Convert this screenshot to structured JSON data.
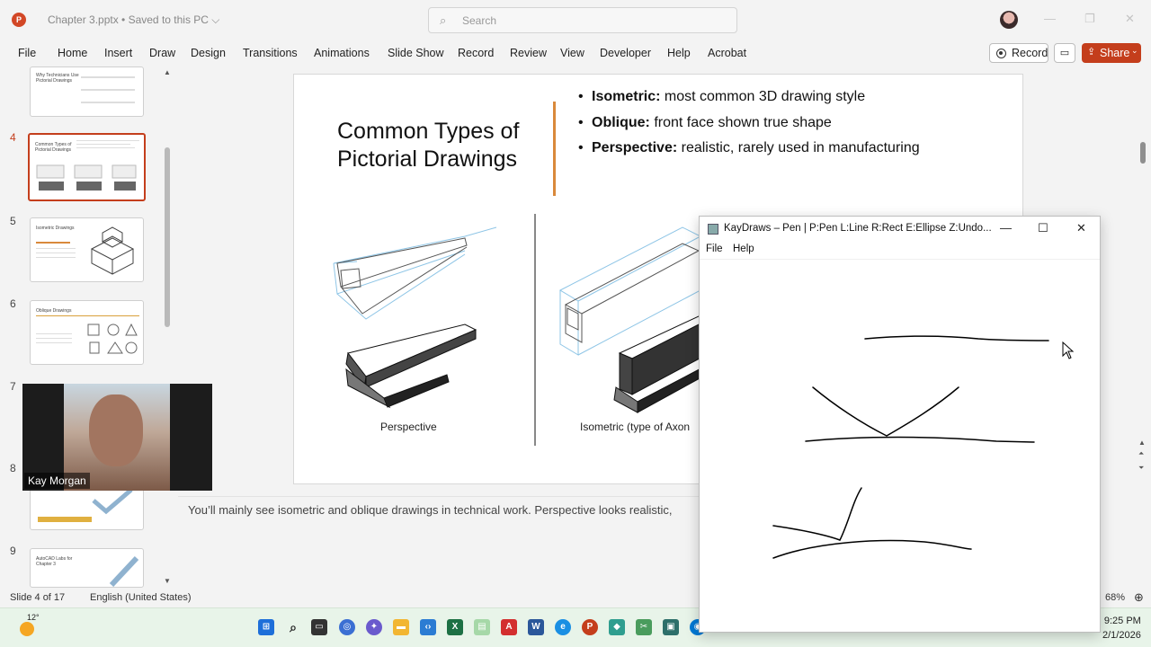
{
  "app": {
    "doc_title": "Chapter 3.pptx • Saved to this PC ⌵",
    "search_placeholder": "Search",
    "window_controls": {
      "minimize": "—",
      "restore": "❐",
      "close": "✕"
    }
  },
  "ribbon": {
    "tabs": [
      "File",
      "Home",
      "Insert",
      "Draw",
      "Design",
      "Transitions",
      "Animations",
      "Slide Show",
      "Record",
      "Review",
      "View",
      "Developer",
      "Help",
      "Acrobat"
    ],
    "record_label": "Record",
    "share_label": "Share"
  },
  "thumbnails": [
    {
      "num": "",
      "title": "Why Technicians Use Pictorial Drawings",
      "active": false
    },
    {
      "num": "4",
      "title": "Common Types of Pictorial Drawings",
      "active": true
    },
    {
      "num": "5",
      "title": "Isometric Drawings",
      "active": false
    },
    {
      "num": "6",
      "title": "Oblique Drawings",
      "active": false
    },
    {
      "num": "7",
      "title": "",
      "active": false
    },
    {
      "num": "8",
      "title": "",
      "active": false
    },
    {
      "num": "9",
      "title": "AutoCAD Labs for Chapter 3",
      "active": false
    }
  ],
  "webcam": {
    "name": "Kay Morgan"
  },
  "slide": {
    "title": "Common Types of Pictorial Drawings",
    "bullets": [
      {
        "term": "Isometric:",
        "text": " most common 3D drawing style"
      },
      {
        "term": "Oblique:",
        "text": " front face shown true shape"
      },
      {
        "term": "Perspective:",
        "text": " realistic, rarely used in manufacturing"
      }
    ],
    "captions": {
      "perspective": "Perspective",
      "isometric": "Isometric (type of Axon"
    },
    "accent_color": "#d9893b"
  },
  "notes": {
    "text": "You’ll mainly see isometric and oblique drawings in technical work. Perspective looks realistic,"
  },
  "statusbar": {
    "slide_count": "Slide 4 of 17",
    "language": "English (United States)",
    "zoom": "68%"
  },
  "taskbar": {
    "weather_temp": "12°",
    "time": "9:25 PM",
    "date": "2/1/2026"
  },
  "kaydraws": {
    "title": "KayDraws – Pen  |  P:Pen  L:Line  R:Rect  E:Ellipse  Z:Undo...",
    "menu": [
      "File",
      "Help"
    ],
    "controls": {
      "minimize": "—",
      "maximize": "☐",
      "close": "✕"
    }
  },
  "colors": {
    "brand": "#c43e1c",
    "active_thumb_border": "#c43e1c"
  }
}
